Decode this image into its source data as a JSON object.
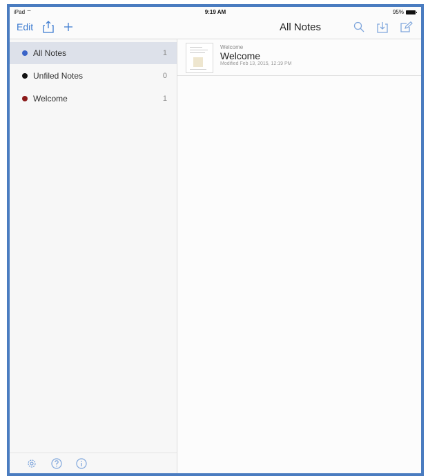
{
  "status_bar": {
    "device": "iPad",
    "time": "9:19 AM",
    "battery": "95%"
  },
  "nav": {
    "edit_label": "Edit",
    "title": "All Notes"
  },
  "sidebar": {
    "items": [
      {
        "label": "All Notes",
        "count": "1",
        "dot_color": "#3a64c8",
        "selected": true
      },
      {
        "label": "Unfiled Notes",
        "count": "0",
        "dot_color": "#111111",
        "selected": false
      },
      {
        "label": "Welcome",
        "count": "1",
        "dot_color": "#8b1a1a",
        "selected": false
      }
    ],
    "footer_icons": [
      "gear-icon",
      "help-icon",
      "info-icon"
    ]
  },
  "notes": [
    {
      "notebook": "Welcome",
      "title": "Welcome",
      "modified": "Modified Feb 13, 2015, 12:19 PM"
    }
  ],
  "colors": {
    "accent": "#3b7ad0",
    "frame": "#4a7cc0"
  }
}
